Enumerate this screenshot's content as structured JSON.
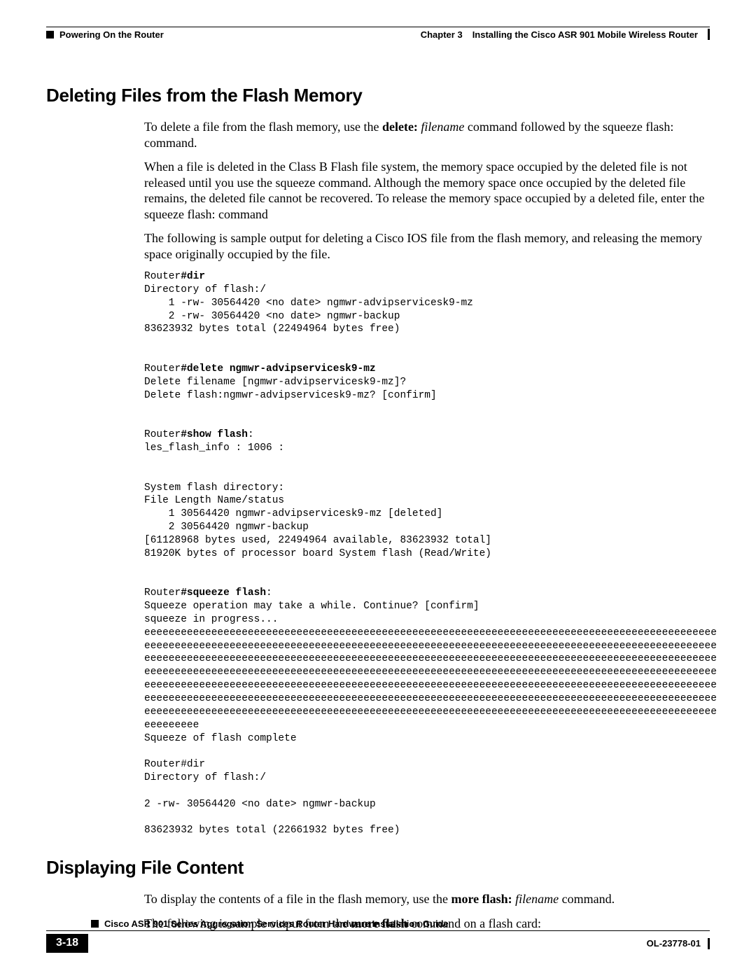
{
  "header": {
    "section": "Powering On the Router",
    "chapter_label": "Chapter 3",
    "chapter_title": "Installing the Cisco ASR 901 Mobile Wireless Router"
  },
  "sections": {
    "deleting": {
      "heading": "Deleting Files from the Flash Memory",
      "p1_a": "To delete a file from the flash memory, use the ",
      "p1_b_bold": "delete:",
      "p1_b_ital": " filename",
      "p1_c": " command followed by the squeeze flash: command.",
      "p2": "When a file is deleted in the Class B Flash file system, the memory space occupied by the deleted file is not released until you use the squeeze command. Although the memory space once occupied by the deleted file remains, the deleted file cannot be recovered. To release the memory space occupied by a deleted file, enter the squeeze flash: command",
      "p3": "The following is sample output for deleting a Cisco IOS file from the flash memory, and releasing the memory space originally occupied by the file."
    },
    "displaying": {
      "heading": "Displaying File Content",
      "p1_a": "To display the contents of a file in the flash memory, use the ",
      "p1_b_bold": "more flash:",
      "p1_b_ital": " filename",
      "p1_c": " command.",
      "p2_a": "The following is sample output from the ",
      "p2_b_bold": "more flash",
      "p2_c": " command on a flash card:"
    }
  },
  "code": {
    "block1_prompt1": "Router",
    "block1_cmd1": "#dir",
    "block1_l2": "Directory of flash:/",
    "block1_l3": "    1 -rw- 30564420 <no date> ngmwr-advipservicesk9-mz",
    "block1_l4": "    2 -rw- 30564420 <no date> ngmwr-backup",
    "block1_l5": "83623932 bytes total (22494964 bytes free)",
    "block2_prompt": "Router",
    "block2_cmd": "#delete ngmwr-advipservicesk9-mz",
    "block2_l2": "Delete filename [ngmwr-advipservicesk9-mz]?",
    "block2_l3": "Delete flash:ngmwr-advipservicesk9-mz? [confirm]",
    "block3_prompt": "Router",
    "block3_cmd": "#show flash",
    "block3_colon": ":",
    "block3_l2": "les_flash_info : 1006 :",
    "block3_l3": "System flash directory:",
    "block3_l4": "File Length Name/status",
    "block3_l5": "    1 30564420 ngmwr-advipservicesk9-mz [deleted]",
    "block3_l6": "    2 30564420 ngmwr-backup",
    "block3_l7": "[61128968 bytes used, 22494964 available, 83623932 total]",
    "block3_l8": "81920K bytes of processor board System flash (Read/Write)",
    "block4_prompt": "Router",
    "block4_cmd": "#squeeze flash",
    "block4_colon": ":",
    "block4_l2": "Squeeze operation may take a while. Continue? [confirm]",
    "block4_l3": "squeeze in progress...",
    "block4_e1": "eeeeeeeeeeeeeeeeeeeeeeeeeeeeeeeeeeeeeeeeeeeeeeeeeeeeeeeeeeeeeeeeeeeeeeeeeeeeeeeeeeeeeeeeeeeeee",
    "block4_e2": "eeeeeeeeeeeeeeeeeeeeeeeeeeeeeeeeeeeeeeeeeeeeeeeeeeeeeeeeeeeeeeeeeeeeeeeeeeeeeeeeeeeeeeeeeeeeee",
    "block4_e3": "eeeeeeeeeeeeeeeeeeeeeeeeeeeeeeeeeeeeeeeeeeeeeeeeeeeeeeeeeeeeeeeeeeeeeeeeeeeeeeeeeeeeeeeeeeeeee",
    "block4_e4": "eeeeeeeeeeeeeeeeeeeeeeeeeeeeeeeeeeeeeeeeeeeeeeeeeeeeeeeeeeeeeeeeeeeeeeeeeeeeeeeeeeeeeeeeeeeeee",
    "block4_e5": "eeeeeeeeeeeeeeeeeeeeeeeeeeeeeeeeeeeeeeeeeeeeeeeeeeeeeeeeeeeeeeeeeeeeeeeeeeeeeeeeeeeeeeeeeeeeee",
    "block4_e6": "eeeeeeeeeeeeeeeeeeeeeeeeeeeeeeeeeeeeeeeeeeeeeeeeeeeeeeeeeeeeeeeeeeeeeeeeeeeeeeeeeeeeeeeeeeeeee",
    "block4_e7": "eeeeeeeeeeeeeeeeeeeeeeeeeeeeeeeeeeeeeeeeeeeeeeeeeeeeeeeeeeeeeeeeeeeeeeeeeeeeeeeeeeeeeeeeeeeeee",
    "block4_e8": "eeeeeeeee",
    "block4_l4": "Squeeze of flash complete",
    "block4_l5": "Router#dir",
    "block4_l6": "Directory of flash:/",
    "block4_l7": "2 -rw- 30564420 <no date> ngmwr-backup",
    "block4_l8": "83623932 bytes total (22661932 bytes free)"
  },
  "footer": {
    "guide_title": "Cisco ASR 901 Series Aggregation Services Router Hardware Installation Guide",
    "page": "3-18",
    "doc_id": "OL-23778-01"
  }
}
